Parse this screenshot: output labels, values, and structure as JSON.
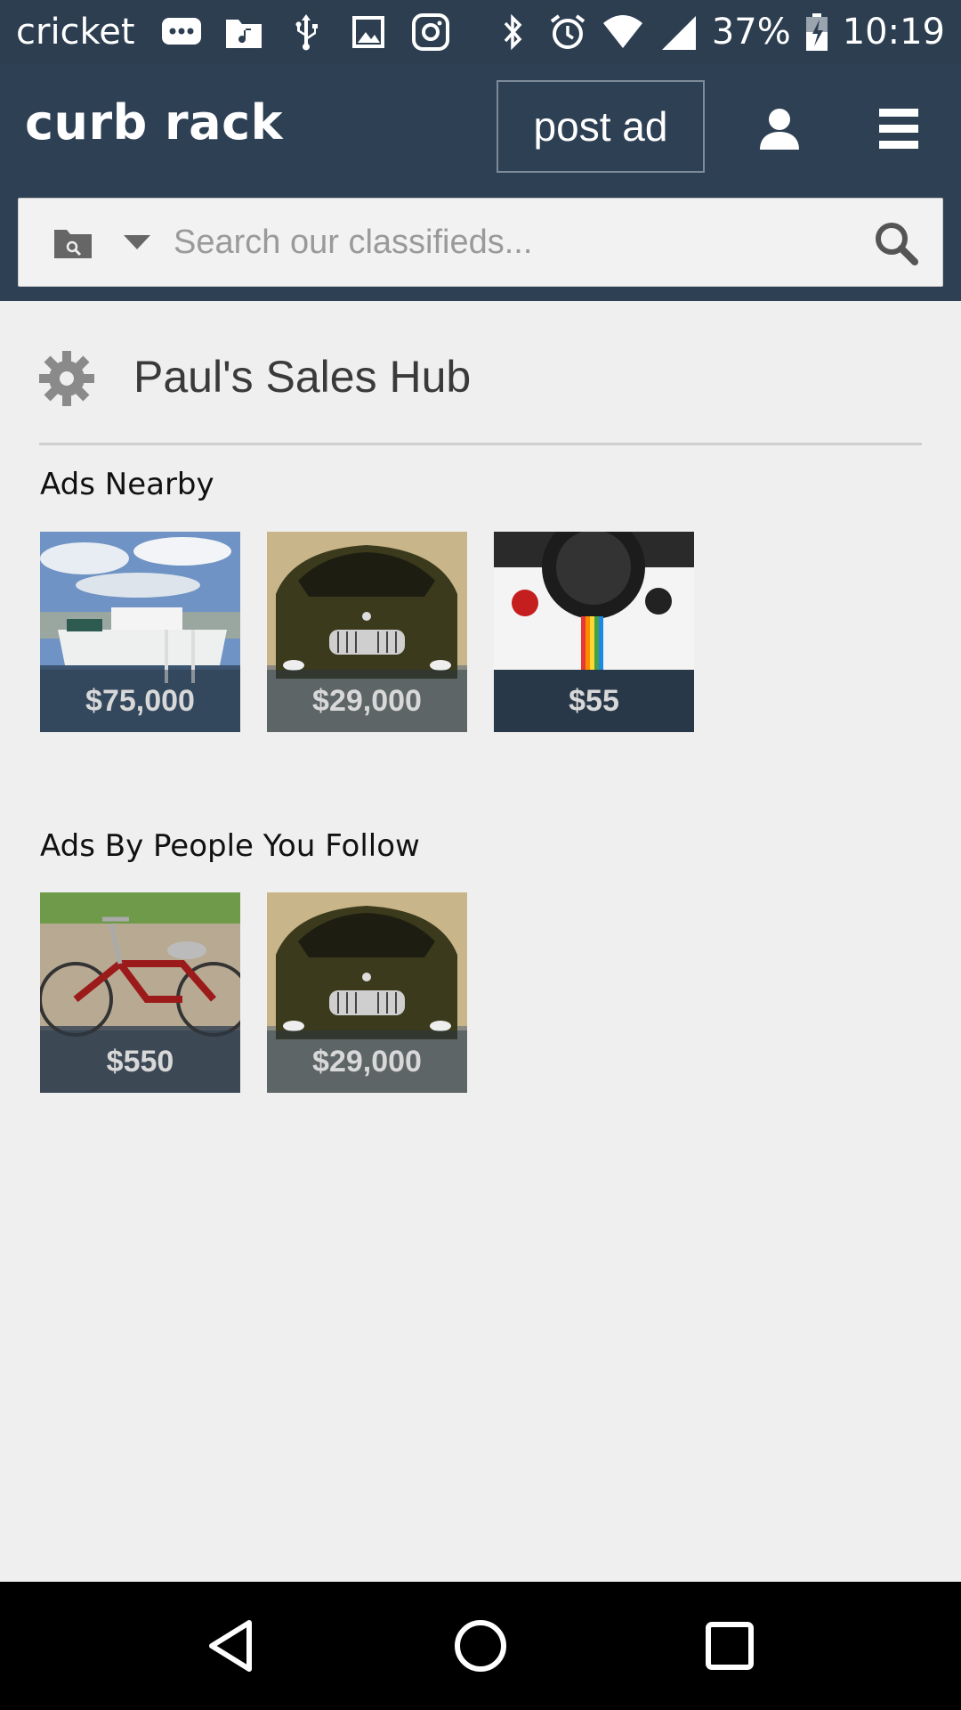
{
  "status_bar": {
    "carrier": "cricket",
    "battery": "37%",
    "time": "10:19"
  },
  "header": {
    "logo": "curb rack",
    "post_ad_label": "post ad"
  },
  "search": {
    "placeholder": "Search our classifieds..."
  },
  "hub": {
    "title": "Paul's Sales Hub"
  },
  "sections": {
    "nearby": {
      "title": "Ads Nearby",
      "items": [
        {
          "image": "boat",
          "price": "$75,000"
        },
        {
          "image": "car",
          "price": "$29,000"
        },
        {
          "image": "camera",
          "price": "$55"
        }
      ]
    },
    "following": {
      "title": "Ads By People You Follow",
      "items": [
        {
          "image": "bicycle",
          "price": "$550"
        },
        {
          "image": "car",
          "price": "$29,000"
        }
      ]
    }
  },
  "icons": [
    "message-icon",
    "folder-music-icon",
    "usb-icon",
    "image-icon",
    "instagram-icon",
    "bluetooth-icon",
    "alarm-icon",
    "wifi-icon",
    "signal-icon",
    "battery-icon",
    "user-icon",
    "menu-icon",
    "category-folder-icon",
    "caret-down-icon",
    "search-icon",
    "gear-icon",
    "back-icon",
    "home-icon",
    "recents-icon"
  ]
}
